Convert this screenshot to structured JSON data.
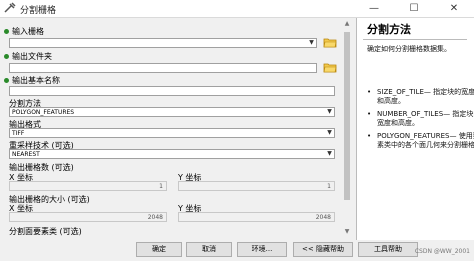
{
  "window": {
    "title": "分割栅格",
    "minimize": "—",
    "maximize": "☐",
    "close": "✕"
  },
  "form": {
    "input_raster_label": "输入栅格",
    "output_folder_label": "输出文件夹",
    "base_name_label": "输出基本名称",
    "split_method_label": "分割方法",
    "split_method_value": "POLYGON_FEATURES",
    "output_format_label": "输出格式",
    "output_format_value": "TIFF",
    "resample_label": "重采样技术 (可选)",
    "resample_value": "NEAREST",
    "tile_count_label": "输出栅格数 (可选)",
    "x_coord_label": "X 坐标",
    "y_coord_label": "Y 坐标",
    "tile_count_x_value": "1",
    "tile_count_y_value": "1",
    "tile_size_label": "输出栅格的大小 (可选)",
    "x_coord_label2": "X 坐标",
    "y_coord_label2": "Y 坐标",
    "tile_size_x_value": "2048",
    "tile_size_y_value": "2048",
    "split_features_label": "分割面要素类 (可选)"
  },
  "help": {
    "title": "分割方法",
    "description": "确定如何分割栅格数据集。",
    "items": [
      "SIZE_OF_TILE— 指定块的宽度和高度。",
      "NUMBER_OF_TILES— 指定块的宽度和高度。",
      "POLYGON_FEATURES— 使用要素类中的各个面几何来分割栅格"
    ]
  },
  "buttons": {
    "ok": "确定",
    "cancel": "取消",
    "environments": "环境...",
    "hide_help": "<< 隐藏帮助",
    "tool_help": "工具帮助"
  },
  "watermark": "CSDN @WW_2001"
}
